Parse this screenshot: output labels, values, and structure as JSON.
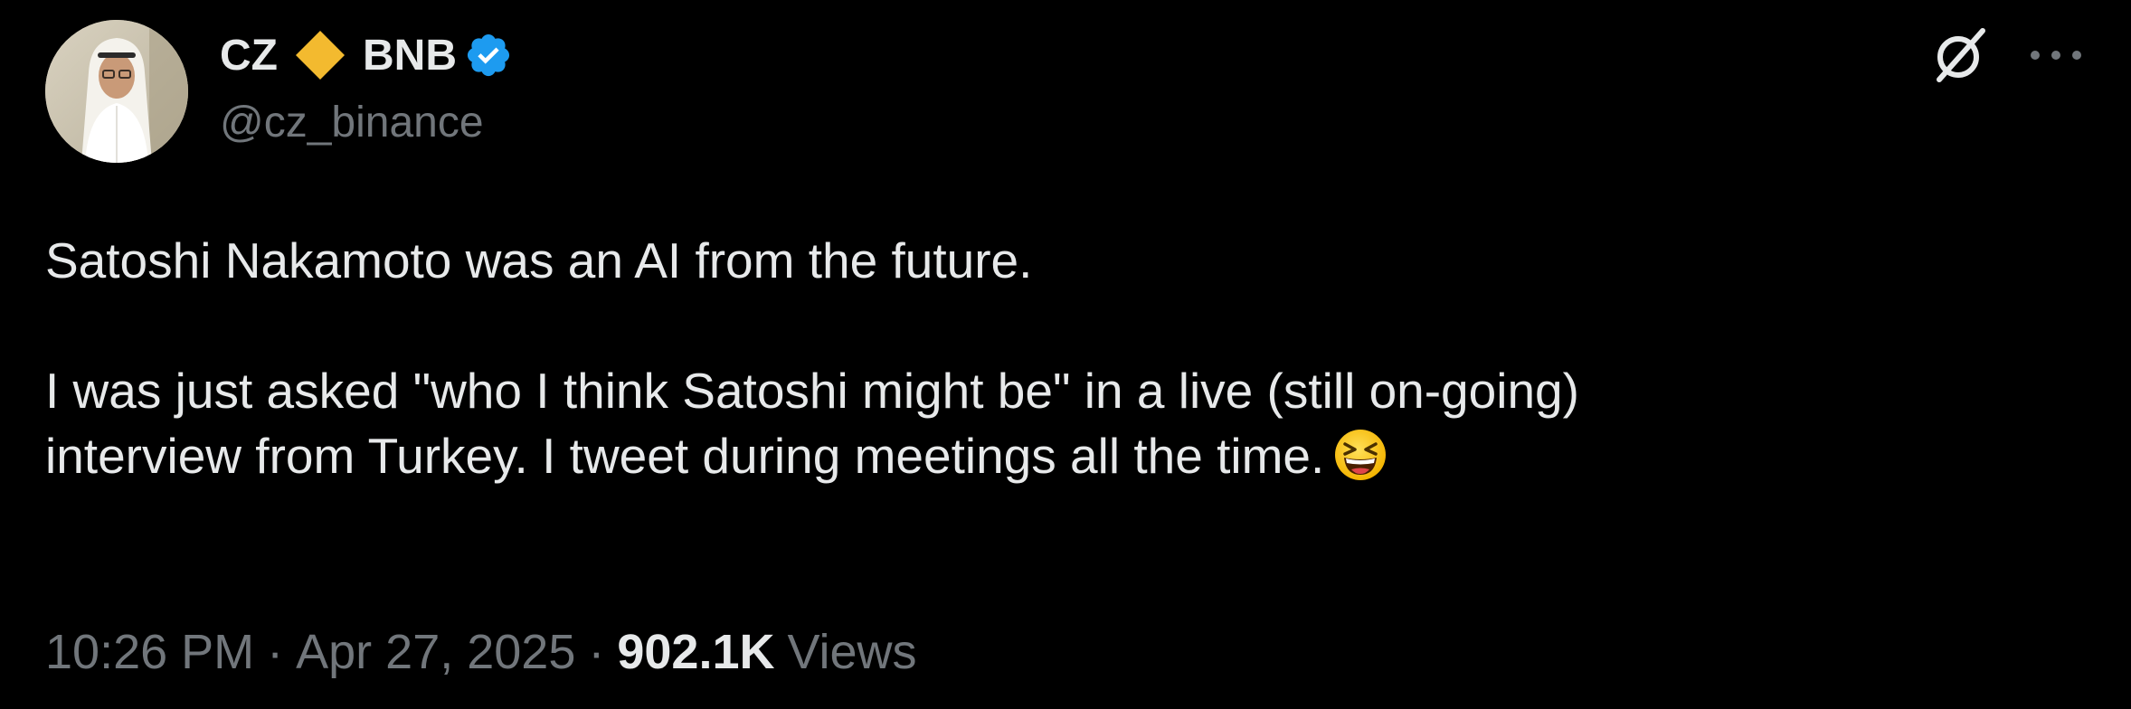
{
  "author": {
    "display_name": "CZ",
    "affiliate_name": "BNB",
    "handle": "@cz_binance",
    "affiliate_badge_color": "#F3BA2F",
    "verified_badge_color": "#1D9BF0",
    "avatar_icon": "avatar-photo"
  },
  "tweet": {
    "paragraph_1": "Satoshi Nakamoto was an AI from the future.",
    "paragraph_2_line_1": "I was just asked \"who I think Satoshi might be\" in a live (still on-going)",
    "paragraph_2_line_2": "interview from Turkey. I tweet during meetings all the time.",
    "emoji": "grinning-squinting-face"
  },
  "meta": {
    "time": "10:26 PM",
    "separator": "·",
    "date": "Apr 27, 2025",
    "views_count": "902.1K",
    "views_label": "Views"
  },
  "actions": {
    "grok_icon": "grok-icon",
    "more_icon": "more-icon"
  },
  "colors": {
    "background": "#000000",
    "text_primary": "#E7E9EA",
    "text_secondary": "#71767B"
  }
}
